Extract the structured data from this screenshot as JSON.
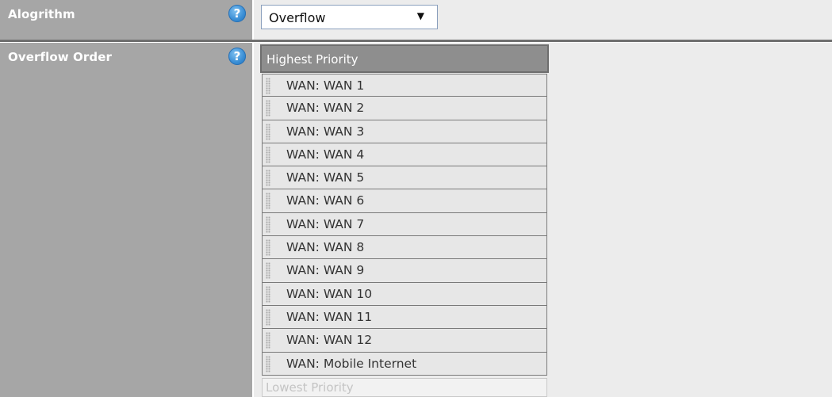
{
  "algorithm_row": {
    "label": "Alogrithm",
    "help_icon": "question-circle-icon",
    "select": {
      "value": "Overflow",
      "arrow": "▼"
    }
  },
  "overflow_order_row": {
    "label": "Overflow Order",
    "help_icon": "question-circle-icon",
    "header": "Highest Priority",
    "items": [
      "WAN: WAN 1",
      "WAN: WAN 2",
      "WAN: WAN 3",
      "WAN: WAN 4",
      "WAN: WAN 5",
      "WAN: WAN 6",
      "WAN: WAN 7",
      "WAN: WAN 8",
      "WAN: WAN 9",
      "WAN: WAN 10",
      "WAN: WAN 11",
      "WAN: WAN 12",
      "WAN: Mobile Internet"
    ],
    "footer": "Lowest Priority"
  },
  "colors": {
    "label_bg": "#a6a6a6",
    "value_bg": "#ececec",
    "help_icon": "#3b8fd6",
    "header_bg": "#8e8e8e",
    "item_bg": "#e7e7e7"
  }
}
